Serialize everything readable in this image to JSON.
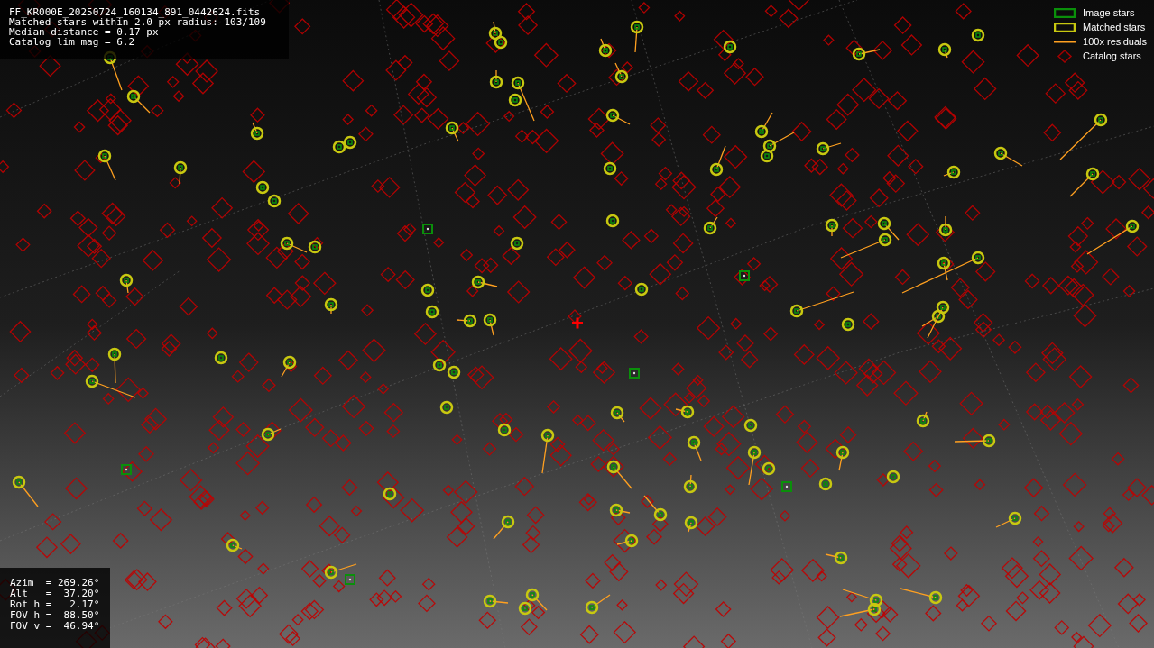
{
  "info_panel": {
    "lines": [
      "FF_KR000E_20250724_160134_891_0442624.fits",
      "Matched stars within 2.0 px radius: 103/109",
      "Median distance = 0.17 px",
      "Catalog lim mag = 6.2"
    ]
  },
  "legend": [
    {
      "kind": "image",
      "label": "Image stars"
    },
    {
      "kind": "matched",
      "label": "Matched stars"
    },
    {
      "kind": "residual",
      "label": "100x residuals"
    },
    {
      "kind": "catalog",
      "label": "Catalog stars"
    }
  ],
  "pointing_panel": {
    "lines": [
      "Azim  = 269.26°",
      "Alt   =  37.20°",
      "Rot h =   2.17°",
      "FOV h =  88.50°",
      "FOV v =  46.94°"
    ]
  }
}
